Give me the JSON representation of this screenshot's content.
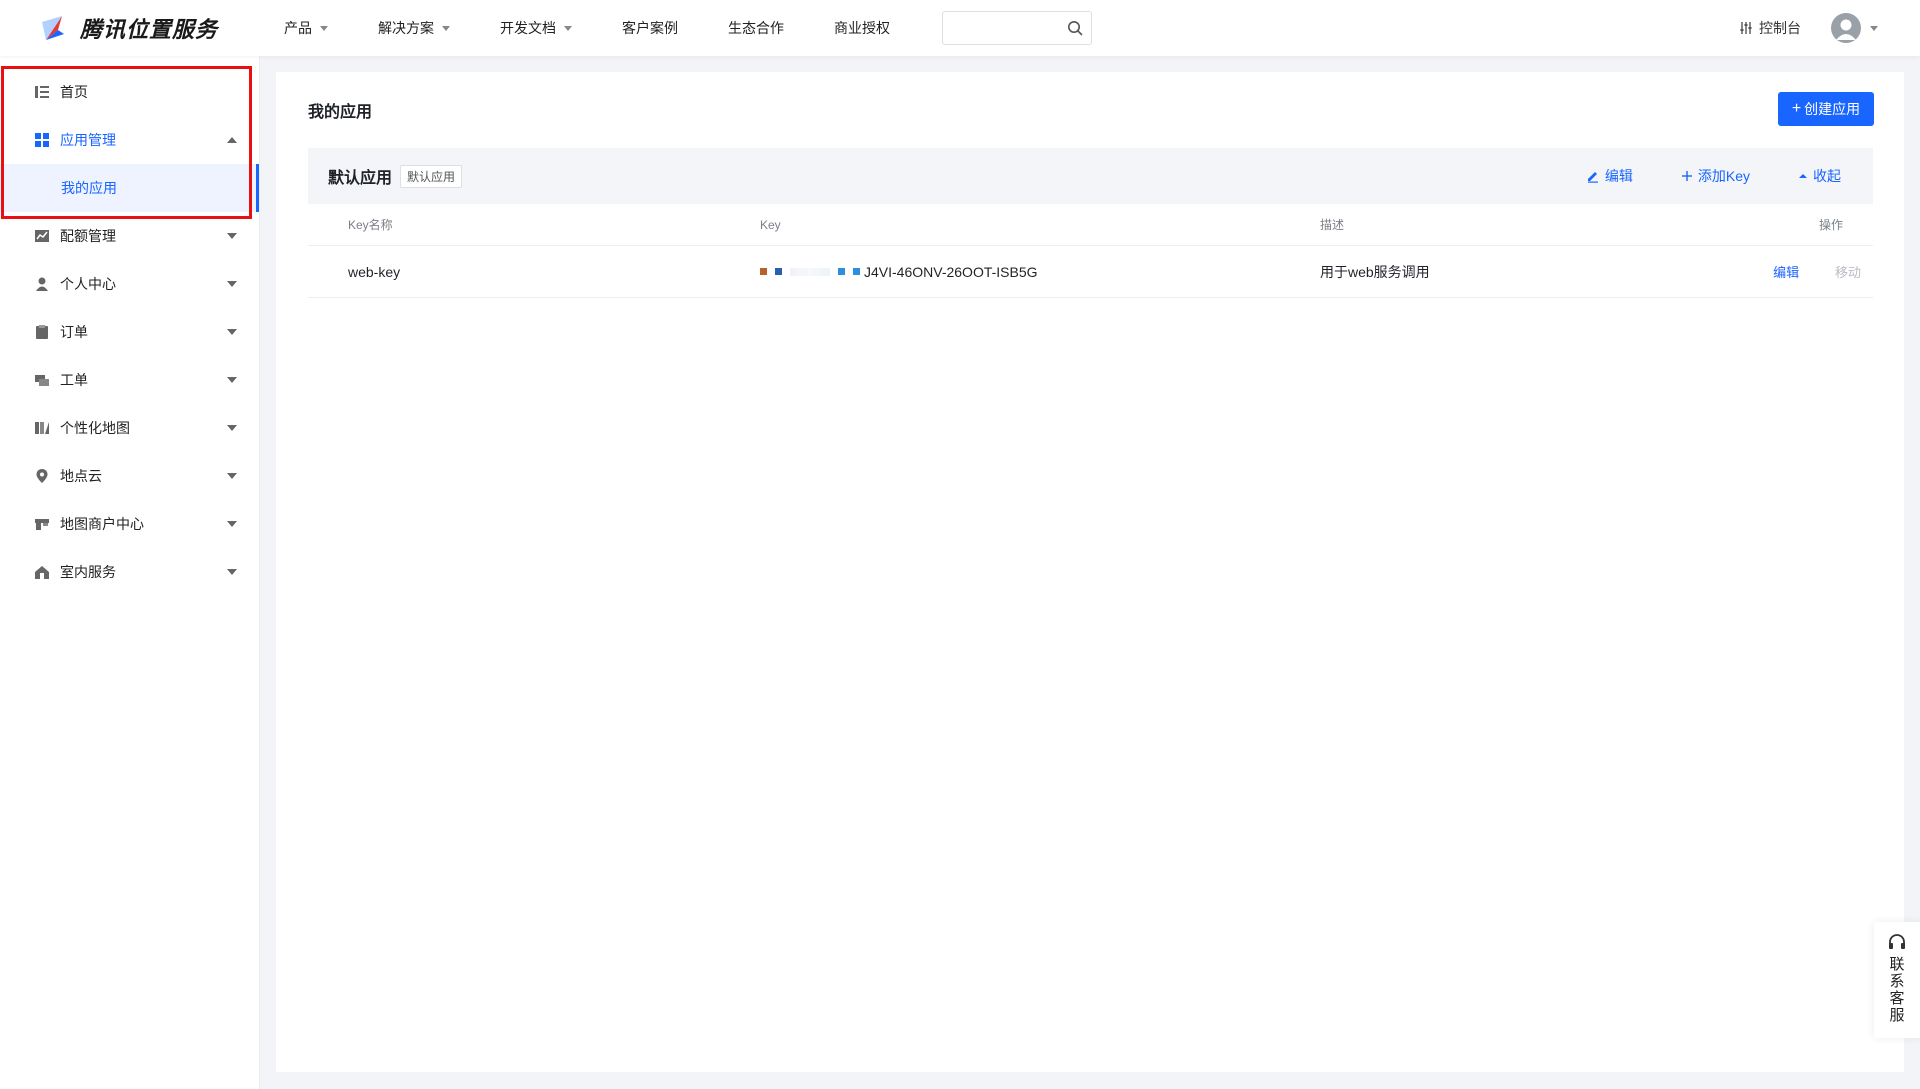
{
  "brand": {
    "name": "腾讯位置服务"
  },
  "nav": {
    "items": [
      {
        "label": "产品",
        "dropdown": true
      },
      {
        "label": "解决方案",
        "dropdown": true
      },
      {
        "label": "开发文档",
        "dropdown": true
      },
      {
        "label": "客户案例",
        "dropdown": false
      },
      {
        "label": "生态合作",
        "dropdown": false
      },
      {
        "label": "商业授权",
        "dropdown": false
      }
    ],
    "search": {
      "value": "",
      "placeholder": ""
    },
    "console_label": "控制台"
  },
  "sidebar": {
    "items": [
      {
        "label": "首页",
        "icon": "list-icon"
      },
      {
        "label": "应用管理",
        "icon": "grid-icon",
        "expanded": true,
        "children": [
          {
            "label": "我的应用"
          }
        ]
      },
      {
        "label": "配额管理",
        "icon": "chart-icon"
      },
      {
        "label": "个人中心",
        "icon": "user-icon"
      },
      {
        "label": "订单",
        "icon": "clipboard-icon"
      },
      {
        "label": "工单",
        "icon": "ticket-icon"
      },
      {
        "label": "个性化地图",
        "icon": "map-style-icon"
      },
      {
        "label": "地点云",
        "icon": "location-pin-icon"
      },
      {
        "label": "地图商户中心",
        "icon": "store-icon"
      },
      {
        "label": "室内服务",
        "icon": "indoor-icon"
      }
    ]
  },
  "main": {
    "title": "我的应用",
    "create_label": "创建应用",
    "app": {
      "name": "默认应用",
      "tag": "默认应用",
      "actions": {
        "edit": "编辑",
        "add_key": "添加Key",
        "collapse": "收起"
      },
      "columns": {
        "name": "Key名称",
        "key": "Key",
        "desc": "描述",
        "ops": "操作"
      },
      "rows": [
        {
          "name": "web-key",
          "key_visible": "J4VI-46ONV-26OOT-ISB5G",
          "desc": "用于web服务调用",
          "op_edit": "编辑",
          "op_move": "移动"
        }
      ]
    }
  },
  "float_service": {
    "label": "联系客服"
  },
  "colors": {
    "accent": "#1965ff",
    "highlight_box": "#e81010"
  }
}
